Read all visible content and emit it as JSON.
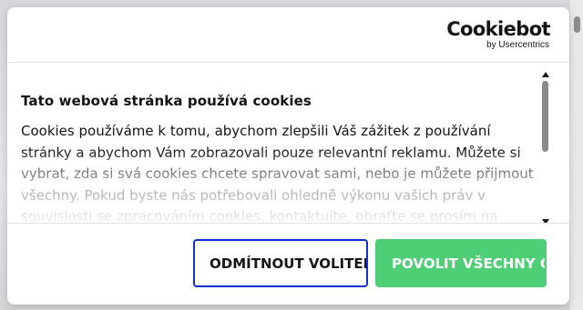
{
  "logo": {
    "main": "Cookiebot",
    "sub": "by Usercentrics"
  },
  "content": {
    "title": "Tato webová stránka používá cookies",
    "text": "Cookies používáme k tomu, abychom zlepšili Váš zážitek z používání stránky a abychom Vám zobrazovali pouze relevantní reklamu. Můžete si vybrat, zda si svá cookies chcete spravovat sami, nebo je můžete přijmout všechny. Pokud byste nás potřebovali ohledně výkonu vašich práv v souvislosti se zpracováním cookies, kontaktujte, obraťte se prosím na"
  },
  "buttons": {
    "decline": "ODMÍTNOUT VOLITELNÉ COOKIES",
    "allow": "POVOLIT VŠECHNY COOKIES"
  },
  "colors": {
    "decline_border": "#1032cf",
    "allow_bg": "#4ecf75"
  }
}
